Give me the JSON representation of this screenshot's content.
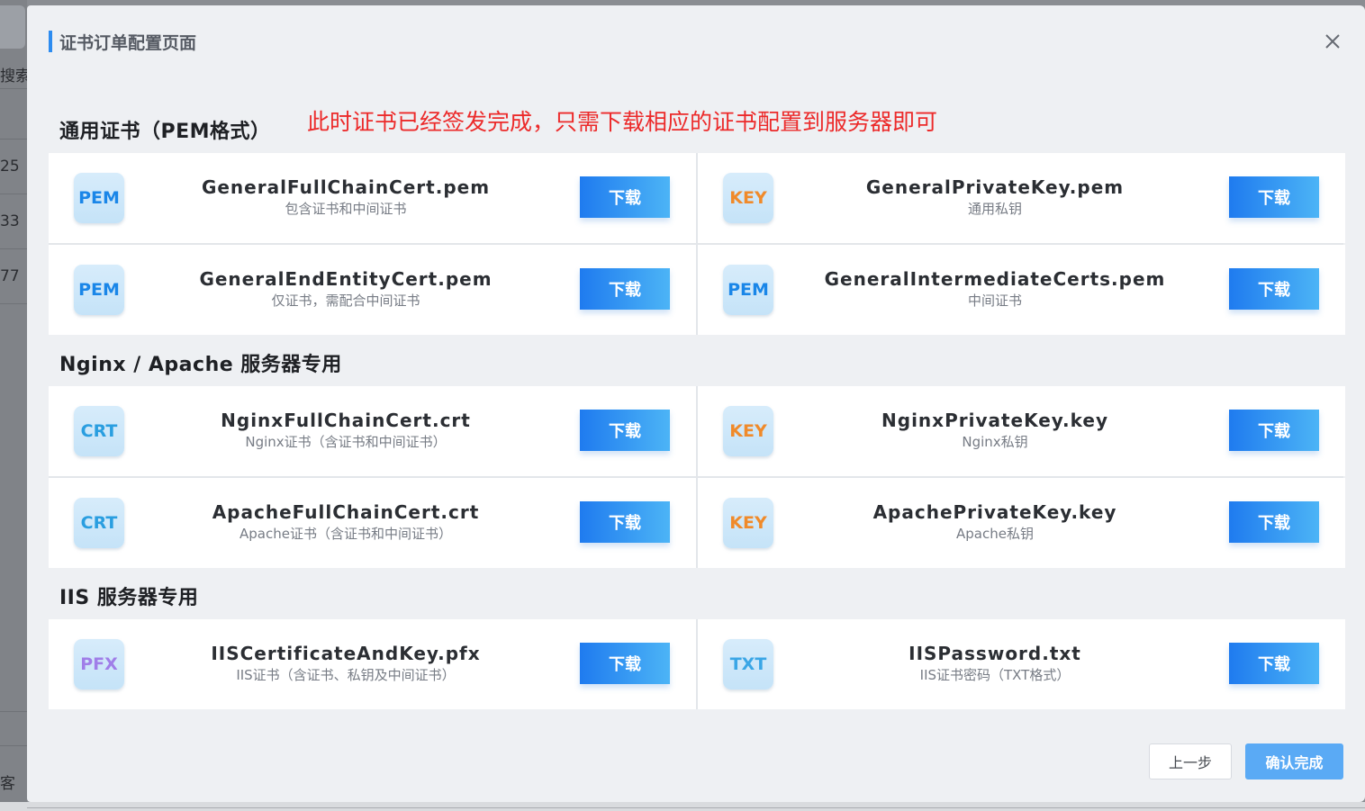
{
  "background": {
    "search_fragment": "搜索.",
    "row_numbers": [
      "25",
      "33",
      "77"
    ],
    "bottom_fragment": "客"
  },
  "dialog": {
    "title": "证书订单配置页面",
    "close_icon": "close-icon"
  },
  "annotation": "此时证书已经签发完成，只需下载相应的证书配置到服务器即可",
  "sections": [
    {
      "title": "通用证书（PEM格式）",
      "cards": [
        {
          "badge": "PEM",
          "type": "pem",
          "name": "GeneralFullChainCert.pem",
          "desc": "包含证书和中间证书",
          "button": "下载"
        },
        {
          "badge": "KEY",
          "type": "key",
          "name": "GeneralPrivateKey.pem",
          "desc": "通用私钥",
          "button": "下载"
        },
        {
          "badge": "PEM",
          "type": "pem",
          "name": "GeneralEndEntityCert.pem",
          "desc": "仅证书，需配合中间证书",
          "button": "下载"
        },
        {
          "badge": "PEM",
          "type": "pem",
          "name": "GeneralIntermediateCerts.pem",
          "desc": "中间证书",
          "button": "下载"
        }
      ]
    },
    {
      "title": "Nginx / Apache 服务器专用",
      "cards": [
        {
          "badge": "CRT",
          "type": "crt",
          "name": "NginxFullChainCert.crt",
          "desc": "Nginx证书（含证书和中间证书）",
          "button": "下载"
        },
        {
          "badge": "KEY",
          "type": "key",
          "name": "NginxPrivateKey.key",
          "desc": "Nginx私钥",
          "button": "下载"
        },
        {
          "badge": "CRT",
          "type": "crt",
          "name": "ApacheFullChainCert.crt",
          "desc": "Apache证书（含证书和中间证书）",
          "button": "下载"
        },
        {
          "badge": "KEY",
          "type": "key",
          "name": "ApachePrivateKey.key",
          "desc": "Apache私钥",
          "button": "下载"
        }
      ]
    },
    {
      "title": "IIS 服务器专用",
      "cards": [
        {
          "badge": "PFX",
          "type": "pfx",
          "name": "IISCertificateAndKey.pfx",
          "desc": "IIS证书（含证书、私钥及中间证书）",
          "button": "下载"
        },
        {
          "badge": "TXT",
          "type": "txt",
          "name": "IISPassword.txt",
          "desc": "IIS证书密码（TXT格式）",
          "button": "下载"
        }
      ]
    }
  ],
  "footer": {
    "prev_label": "上一步",
    "confirm_label": "确认完成"
  },
  "colors": {
    "accent": "#2d8cf0",
    "annotation": "#ec2a2a",
    "badge_pem": "#1a86e8",
    "badge_key": "#f08a2a",
    "badge_pfx": "#a07ee8"
  }
}
